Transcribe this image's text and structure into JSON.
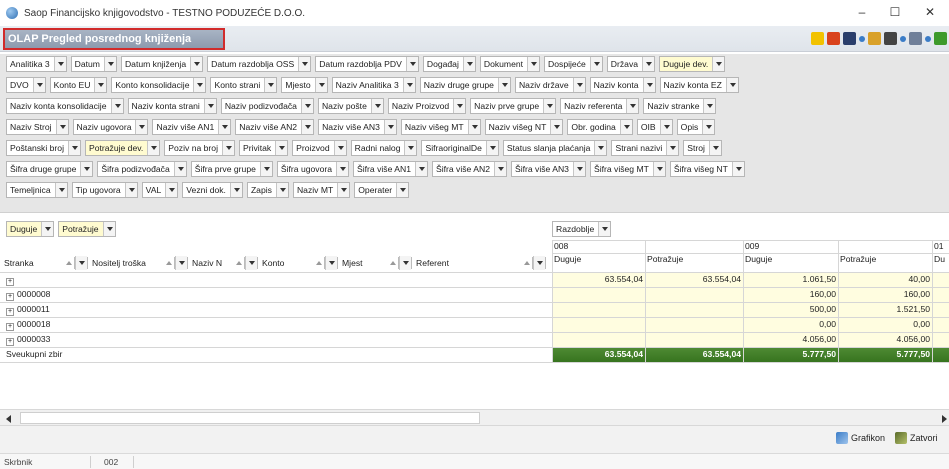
{
  "window": {
    "title": "Saop Financijsko knjigovodstvo - TESTNO PODUZEĆE D.O.O.",
    "minimize": "–",
    "maximize": "☐",
    "close": "✕"
  },
  "module": {
    "title": "OLAP Pregled posrednog knjiženja"
  },
  "toolbar_icons": [
    {
      "name": "star-icon",
      "color": "#f2c200"
    },
    {
      "name": "export-icon",
      "color": "#d9421c"
    },
    {
      "name": "save-icon",
      "color": "#2a3e6b"
    },
    {
      "name": "arrow-right-icon",
      "color": "#3a7cc7"
    },
    {
      "name": "open-folder-icon",
      "color": "#d9a12a"
    },
    {
      "name": "print-icon",
      "color": "#444444"
    },
    {
      "name": "arrow-right-icon",
      "color": "#3a7cc7"
    },
    {
      "name": "copy-icon",
      "color": "#6f7f99"
    },
    {
      "name": "arrow-right-icon",
      "color": "#3a7cc7"
    },
    {
      "name": "refresh-icon",
      "color": "#3d9a2b"
    }
  ],
  "field_rows": [
    [
      {
        "label": "Analitika 3"
      },
      {
        "label": "Datum"
      },
      {
        "label": "Datum knjiženja"
      },
      {
        "label": "Datum razdoblja OSS"
      },
      {
        "label": "Datum razdoblja PDV"
      },
      {
        "label": "Događaj"
      },
      {
        "label": "Dokument"
      },
      {
        "label": "Dospijeće"
      },
      {
        "label": "Država"
      },
      {
        "label": "Duguje dev.",
        "highlight": true
      }
    ],
    [
      {
        "label": "DVO"
      },
      {
        "label": "Konto EU"
      },
      {
        "label": "Konto konsolidacije"
      },
      {
        "label": "Konto strani"
      },
      {
        "label": "Mjesto"
      },
      {
        "label": "Naziv Analitika 3"
      },
      {
        "label": "Naziv druge grupe"
      },
      {
        "label": "Naziv države"
      },
      {
        "label": "Naziv konta"
      },
      {
        "label": "Naziv konta EZ"
      }
    ],
    [
      {
        "label": "Naziv konta konsolidacije"
      },
      {
        "label": "Naziv konta strani"
      },
      {
        "label": "Naziv podizvođača"
      },
      {
        "label": "Naziv pošte"
      },
      {
        "label": "Naziv Proizvod"
      },
      {
        "label": "Naziv prve grupe"
      },
      {
        "label": "Naziv referenta"
      },
      {
        "label": "Naziv stranke"
      }
    ],
    [
      {
        "label": "Naziv Stroj"
      },
      {
        "label": "Naziv ugovora"
      },
      {
        "label": "Naziv više AN1"
      },
      {
        "label": "Naziv više AN2"
      },
      {
        "label": "Naziv više AN3"
      },
      {
        "label": "Naziv višeg MT"
      },
      {
        "label": "Naziv višeg NT"
      },
      {
        "label": "Obr. godina"
      },
      {
        "label": "OIB"
      },
      {
        "label": "Opis"
      }
    ],
    [
      {
        "label": "Poštanski broj"
      },
      {
        "label": "Potražuje dev.",
        "highlight": true
      },
      {
        "label": "Poziv na broj"
      },
      {
        "label": "Privitak"
      },
      {
        "label": "Proizvod"
      },
      {
        "label": "Radni nalog"
      },
      {
        "label": "SifraoriginalDe"
      },
      {
        "label": "Status slanja plaćanja"
      },
      {
        "label": "Strani nazivi"
      },
      {
        "label": "Stroj"
      }
    ],
    [
      {
        "label": "Šifra druge grupe"
      },
      {
        "label": "Šifra podizvođača"
      },
      {
        "label": "Šifra prve grupe"
      },
      {
        "label": "Šifra ugovora"
      },
      {
        "label": "Šifra više AN1"
      },
      {
        "label": "Šifra više AN2"
      },
      {
        "label": "Šifra više AN3"
      },
      {
        "label": "Šifra višeg MT"
      },
      {
        "label": "Šifra višeg NT"
      }
    ],
    [
      {
        "label": "Temeljnica"
      },
      {
        "label": "Tip ugovora"
      },
      {
        "label": "VAL"
      },
      {
        "label": "Vezni dok."
      },
      {
        "label": "Zapis"
      },
      {
        "label": "Naziv MT"
      },
      {
        "label": "Operater"
      }
    ]
  ],
  "data_fields": [
    {
      "label": "Duguje"
    },
    {
      "label": "Potražuje"
    }
  ],
  "column_field": {
    "label": "Razdoblje"
  },
  "row_fields": [
    {
      "label": "Stranka"
    },
    {
      "label": "Nositelj troška"
    },
    {
      "label": "Naziv N"
    },
    {
      "label": "Konto"
    },
    {
      "label": "Mjest"
    },
    {
      "label": "Referent"
    }
  ],
  "periods": [
    "008",
    "009",
    "01"
  ],
  "measure_headers": [
    "Duguje",
    "Potražuje",
    "Duguje",
    "Potražuje",
    "Du"
  ],
  "rows": [
    {
      "label": "",
      "vals": [
        "63.554,04",
        "63.554,04",
        "1.061,50",
        "40,00"
      ]
    },
    {
      "label": "0000008",
      "vals": [
        "",
        "",
        "160,00",
        "160,00"
      ]
    },
    {
      "label": "0000011",
      "vals": [
        "",
        "",
        "500,00",
        "1.521,50"
      ]
    },
    {
      "label": "0000018",
      "vals": [
        "",
        "",
        "0,00",
        "0,00"
      ]
    },
    {
      "label": "0000033",
      "vals": [
        "",
        "",
        "4.056,00",
        "4.056,00"
      ]
    }
  ],
  "total_row": {
    "label": "Sveukupni zbir",
    "vals": [
      "63.554,04",
      "63.554,04",
      "5.777,50",
      "5.777,50"
    ]
  },
  "bottom_buttons": {
    "chart": "Grafikon",
    "close": "Zatvori"
  },
  "status": {
    "label": "Skrbnik",
    "value": "002"
  }
}
